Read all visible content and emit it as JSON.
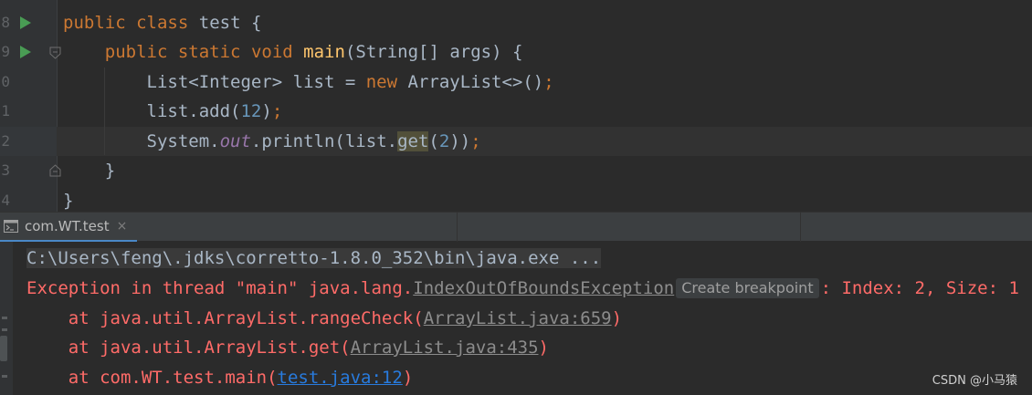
{
  "editor": {
    "line_numbers": [
      "8",
      "9",
      "0",
      "1",
      "2",
      "3",
      "4"
    ],
    "code": {
      "l8": {
        "kw1": "public",
        "kw2": "class",
        "name": "test",
        "brace": "{"
      },
      "l9": {
        "kw1": "public",
        "kw2": "static",
        "kw3": "void",
        "fn": "main",
        "params": "(String[] args) {"
      },
      "l10": {
        "type": "List<Integer> list = ",
        "kw": "new",
        "ctor": "ArrayList<>()",
        "semi": ";"
      },
      "l11": {
        "call": "list.add(",
        "num": "12",
        "close": ")",
        "semi": ";"
      },
      "l12": {
        "obj": "System.",
        "field": "out",
        "call": ".println(list.",
        "get": "get",
        "paren": "(",
        "num": "2",
        "close": "))",
        "semi": ";"
      },
      "l13": {
        "brace": "}"
      },
      "l14": {
        "brace": "}"
      }
    }
  },
  "run_panel": {
    "tab_label": "com.WT.test",
    "close_glyph": "×"
  },
  "console": {
    "command": "C:\\Users\\feng\\.jdks\\corretto-1.8.0_352\\bin\\java.exe ...",
    "exception": {
      "prefix": "Exception in thread \"main\" java.lang.",
      "class_link": "IndexOutOfBoundsException",
      "breakpoint_button": "Create breakpoint",
      "message": ": Index: 2, Size: 1"
    },
    "stack": [
      {
        "prefix": "    at java.util.ArrayList.rangeCheck(",
        "link": "ArrayList.java:659",
        "suffix": ")"
      },
      {
        "prefix": "    at java.util.ArrayList.get(",
        "link": "ArrayList.java:435",
        "suffix": ")"
      },
      {
        "prefix": "    at com.WT.test.main(",
        "link": "test.java:12",
        "suffix": ")"
      }
    ]
  },
  "watermark": "CSDN @小马猿",
  "colors": {
    "keyword": "#cc7832",
    "method": "#ffc66d",
    "number": "#6897bb",
    "error": "#ff6b68",
    "link": "#287bde"
  }
}
